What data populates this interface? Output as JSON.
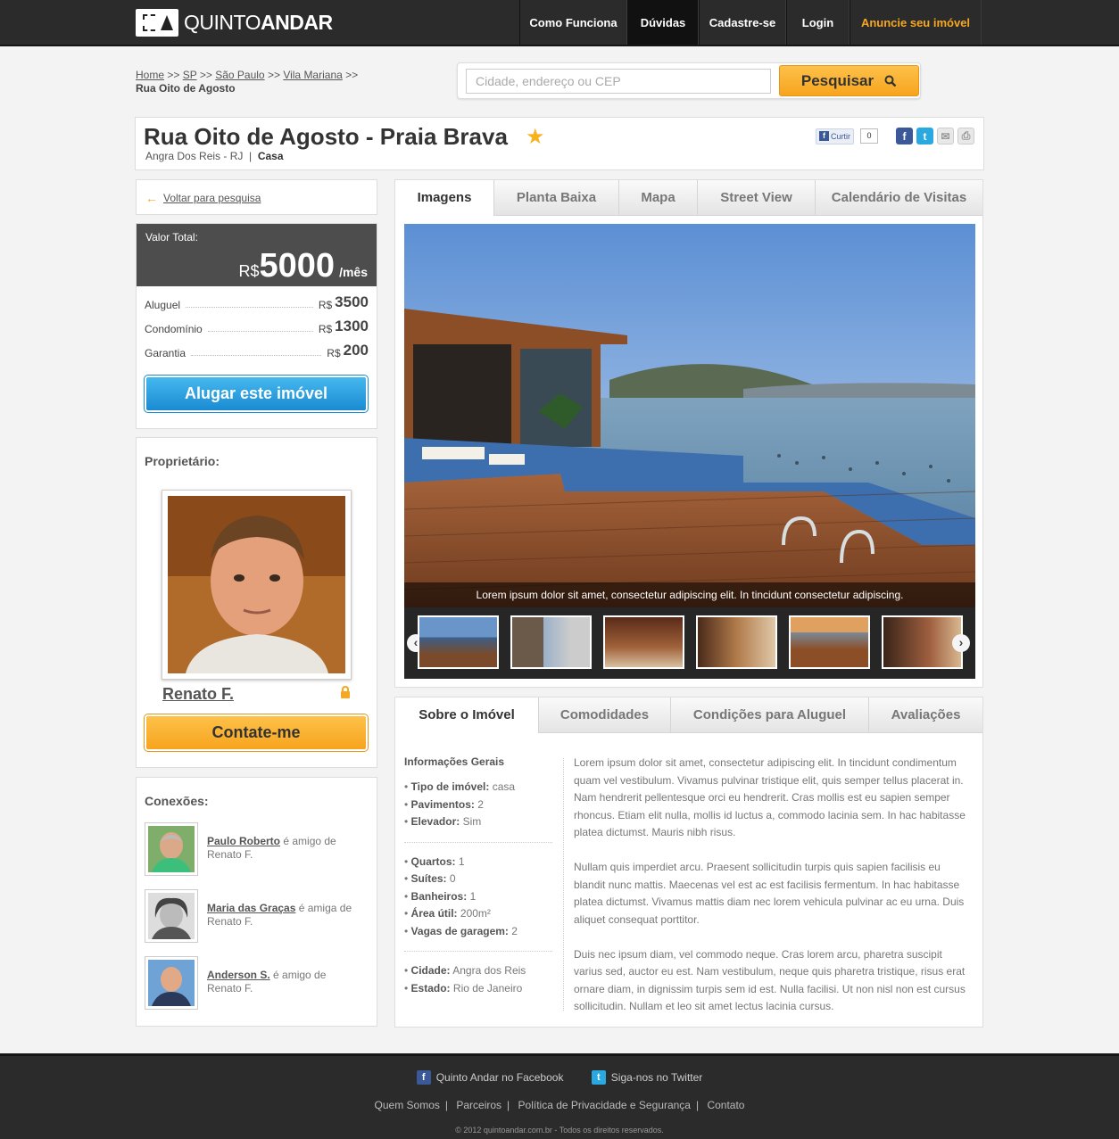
{
  "brand": {
    "name_light": "QUINTO",
    "name_bold": "ANDAR"
  },
  "nav": [
    {
      "label": "Como Funciona",
      "active": false
    },
    {
      "label": "Dúvidas",
      "active": true
    },
    {
      "label": "Cadastre-se",
      "active": false
    },
    {
      "label": "Login",
      "active": false
    },
    {
      "label": "Anuncie seu imóvel",
      "active": false,
      "highlight": true
    }
  ],
  "breadcrumb": {
    "items": [
      "Home",
      "SP",
      "São Paulo",
      "Vila Mariana"
    ],
    "separator": ">>",
    "current": "Rua Oito de Agosto"
  },
  "search": {
    "placeholder": "Cidade, endereço ou CEP",
    "value": "",
    "button_label": "Pesquisar"
  },
  "listing": {
    "title": "Rua Oito de Agosto - Praia Brava",
    "location": "Angra Dos Reis - RJ",
    "divider": "|",
    "type": "Casa",
    "favorited": true
  },
  "social": {
    "like_label": "Curtir",
    "like_count": "0",
    "icons": [
      "facebook-icon",
      "twitter-icon",
      "email-icon",
      "print-icon"
    ]
  },
  "back_link": "Voltar para pesquisa",
  "price": {
    "total_label": "Valor Total:",
    "currency": "R$",
    "total": "5000",
    "period": "/mês",
    "rows": [
      {
        "label": "Aluguel",
        "currency": "R$",
        "value": "3500"
      },
      {
        "label": "Condomínio",
        "currency": "R$",
        "value": "1300"
      },
      {
        "label": "Garantia",
        "currency": "R$",
        "value": "200"
      }
    ],
    "rent_button": "Alugar este imóvel"
  },
  "owner": {
    "heading": "Proprietário:",
    "name": "Renato F.",
    "contact_button": "Contate-me"
  },
  "connections": {
    "heading": "Conexões:",
    "items": [
      {
        "name": "Paulo Roberto",
        "relation": "é amigo de",
        "friend": "Renato F."
      },
      {
        "name": "Maria das Graças",
        "relation": "é amiga de",
        "friend": "Renato F."
      },
      {
        "name": "Anderson S.",
        "relation": "é amigo de",
        "friend": "Renato F."
      }
    ]
  },
  "gallery": {
    "tabs": [
      "Imagens",
      "Planta Baixa",
      "Mapa",
      "Street View",
      "Calendário de Visitas"
    ],
    "active_tab": 0,
    "caption": "Lorem ipsum dolor sit amet, consectetur adipiscing elit. In tincidunt consectetur adipiscing.",
    "thumbnail_count": 6
  },
  "info": {
    "tabs": [
      "Sobre o Imóvel",
      "Comodidades",
      "Condições para Aluguel",
      "Avaliações"
    ],
    "active_tab": 0,
    "general_heading": "Informações Gerais",
    "groups": [
      [
        {
          "label": "Tipo de imóvel:",
          "value": "casa"
        },
        {
          "label": "Pavimentos:",
          "value": "2"
        },
        {
          "label": "Elevador:",
          "value": "Sim"
        }
      ],
      [
        {
          "label": "Quartos:",
          "value": "1"
        },
        {
          "label": "Suítes:",
          "value": "0"
        },
        {
          "label": "Banheiros:",
          "value": "1"
        },
        {
          "label": "Área útil:",
          "value": "200m²"
        },
        {
          "label": "Vagas de garagem:",
          "value": "2"
        }
      ],
      [
        {
          "label": "Cidade:",
          "value": "Angra dos Reis"
        },
        {
          "label": "Estado:",
          "value": "Rio de Janeiro"
        }
      ]
    ],
    "paragraphs": [
      "Lorem ipsum dolor sit amet, consectetur adipiscing elit. In tincidunt condimentum quam vel vestibulum. Vivamus pulvinar tristique elit, quis semper tellus placerat in. Nam hendrerit pellentesque orci eu hendrerit. Cras mollis est eu sapien semper rhoncus. Etiam elit nulla, mollis id luctus a, commodo lacinia sem. In hac habitasse platea dictumst. Mauris nibh risus.",
      "Nullam quis imperdiet arcu. Praesent sollicitudin turpis quis sapien facilisis eu blandit nunc mattis. Maecenas vel est ac est facilisis fermentum. In hac habitasse platea dictumst. Vivamus mattis diam nec lorem vehicula pulvinar ac eu urna. Duis aliquet consequat porttitor.",
      "Duis nec ipsum diam, vel commodo neque. Cras lorem arcu, pharetra suscipit varius sed, auctor eu est. Nam vestibulum, neque quis pharetra tristique, risus erat ornare diam, in dignissim turpis sem id est. Nulla facilisi. Ut non nisl non est cursus sollicitudin. Nullam et leo sit amet lectus lacinia cursus."
    ]
  },
  "footer": {
    "facebook": "Quinto Andar no Facebook",
    "twitter": "Siga-nos no Twitter",
    "links": [
      "Quem Somos",
      "Parceiros",
      "Política de Privacidade e Segurança",
      "Contato"
    ],
    "link_separator": "|",
    "copyright": "© 2012 quintoandar.com.br - Todos os direitos reservados."
  },
  "colors": {
    "accent_orange": "#f7a823",
    "rent_blue": "#1a8bd2",
    "dark_bar": "#2b2b2b"
  }
}
